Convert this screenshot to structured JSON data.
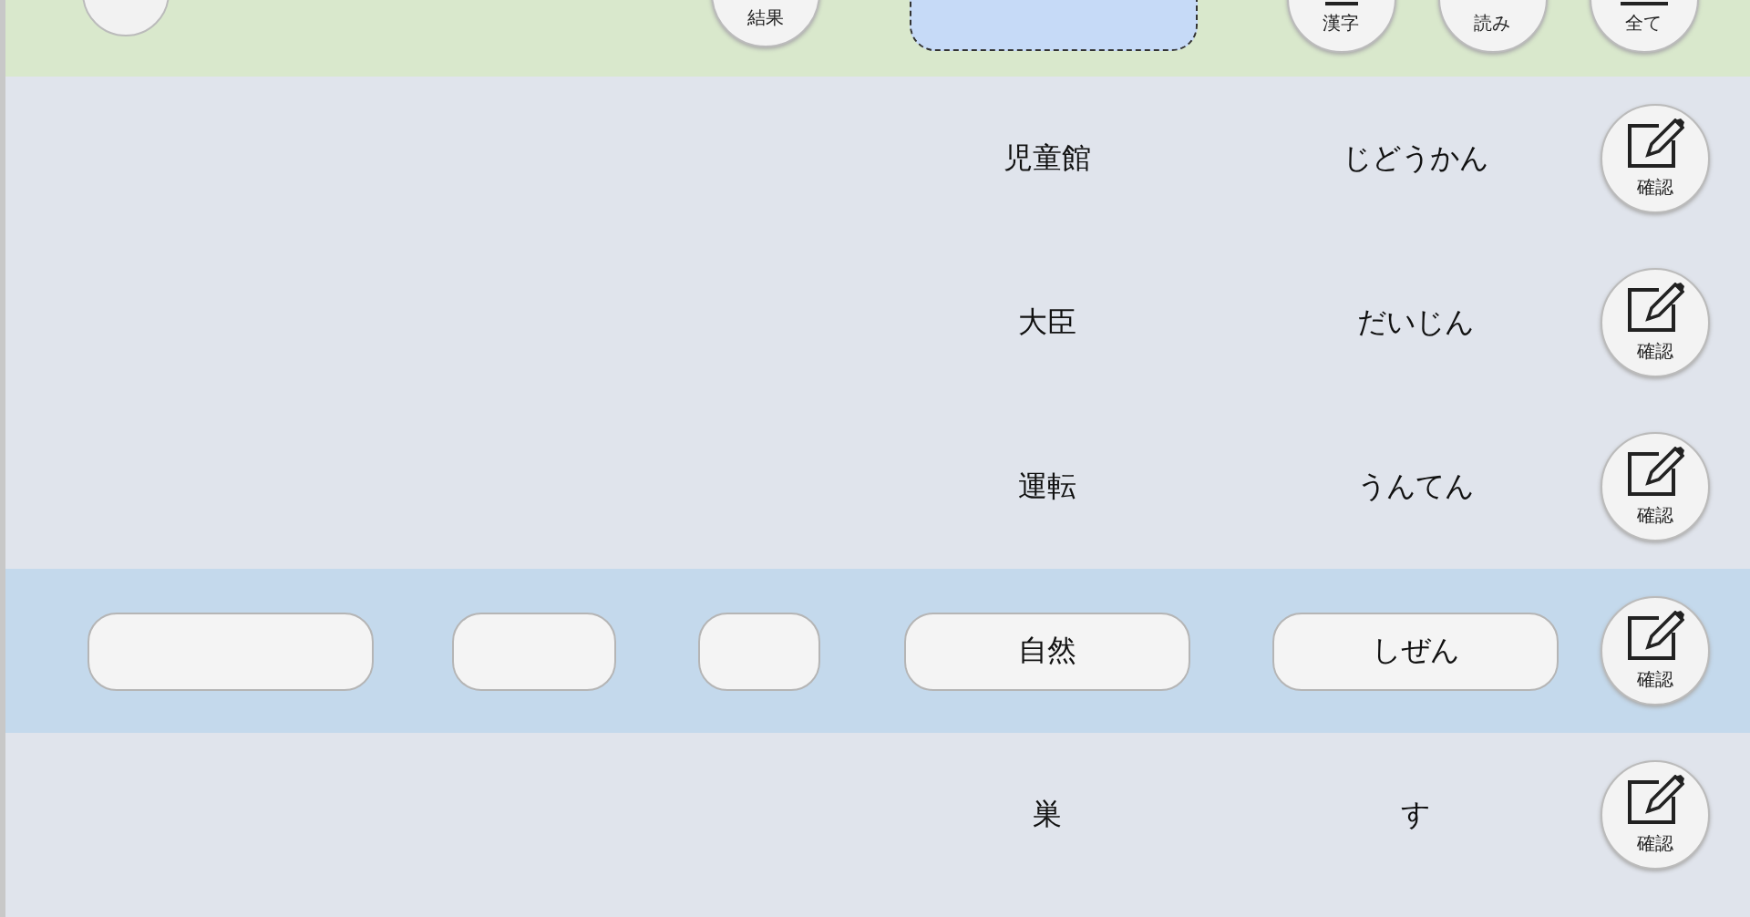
{
  "header": {
    "result_button": {
      "label": "結果"
    },
    "filter_buttons": [
      {
        "label": "漢字",
        "kind": "kanji"
      },
      {
        "label": "読み",
        "kind": "reading"
      },
      {
        "label": "全て",
        "kind": "all"
      }
    ]
  },
  "rows": [
    {
      "kanji": "児童館",
      "reading": "じどうかん",
      "selected": false,
      "confirm": "確認"
    },
    {
      "kanji": "大臣",
      "reading": "だいじん",
      "selected": false,
      "confirm": "確認"
    },
    {
      "kanji": "運転",
      "reading": "うんてん",
      "selected": false,
      "confirm": "確認"
    },
    {
      "kanji": "自然",
      "reading": "しぜん",
      "selected": true,
      "confirm": "確認"
    },
    {
      "kanji": "巣",
      "reading": "す",
      "selected": false,
      "confirm": "確認"
    }
  ]
}
